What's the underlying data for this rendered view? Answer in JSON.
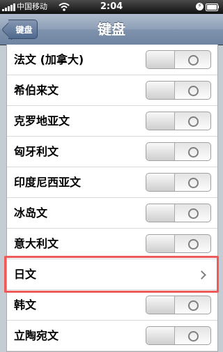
{
  "status_bar": {
    "carrier": "中国移动",
    "time": "2:04",
    "signal_icon": "signal-bars-icon",
    "wifi_icon": "wifi-icon",
    "battery_icon": "battery-charging-icon"
  },
  "nav": {
    "title": "键盘",
    "back_label": "键盘"
  },
  "rows": [
    {
      "label": "法文 (加拿大)",
      "control": "switch",
      "state": "off"
    },
    {
      "label": "希伯来文",
      "control": "switch",
      "state": "off"
    },
    {
      "label": "克罗地亚文",
      "control": "switch",
      "state": "off"
    },
    {
      "label": "匈牙利文",
      "control": "switch",
      "state": "off"
    },
    {
      "label": "印度尼西亚文",
      "control": "switch",
      "state": "off"
    },
    {
      "label": "冰岛文",
      "control": "switch",
      "state": "off"
    },
    {
      "label": "意大利文",
      "control": "switch",
      "state": "off"
    },
    {
      "label": "日文",
      "control": "disclosure"
    },
    {
      "label": "韩文",
      "control": "switch",
      "state": "off"
    },
    {
      "label": "立陶宛文",
      "control": "switch",
      "state": "off"
    }
  ],
  "colors": {
    "highlight": "#ec5b59",
    "nav_bar": "#6f84a1",
    "background": "#c5ccd4"
  }
}
